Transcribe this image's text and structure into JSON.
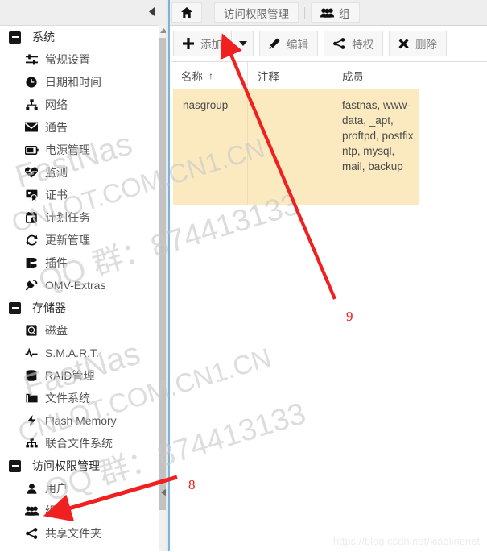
{
  "window": {
    "collapse_sidebar_icon": "triangle-left-icon"
  },
  "breadcrumb": {
    "home_icon": "home-icon",
    "items": [
      {
        "label": "访问权限管理",
        "icon": ""
      },
      {
        "label": "组",
        "icon": "group-icon"
      }
    ]
  },
  "sidebar": {
    "scroll_up_icon": "triangle-up-icon",
    "collapse_handle_icon": "triangle-left-icon",
    "groups": [
      {
        "label": "系统",
        "items": [
          {
            "label": "常规设置",
            "icon": "sliders-icon"
          },
          {
            "label": "日期和时间",
            "icon": "clock-icon"
          },
          {
            "label": "网络",
            "icon": "network-icon"
          },
          {
            "label": "通告",
            "icon": "envelope-icon"
          },
          {
            "label": "电源管理",
            "icon": "battery-icon"
          },
          {
            "label": "监测",
            "icon": "heartbeat-icon"
          },
          {
            "label": "证书",
            "icon": "certificate-icon"
          },
          {
            "label": "计划任务",
            "icon": "calendar-clock-icon"
          },
          {
            "label": "更新管理",
            "icon": "refresh-icon"
          },
          {
            "label": "插件",
            "icon": "plug-puzzle-icon"
          },
          {
            "label": "OMV-Extras",
            "icon": "plug-icon"
          }
        ]
      },
      {
        "label": "存储器",
        "items": [
          {
            "label": "磁盘",
            "icon": "harddisk-icon"
          },
          {
            "label": "S.M.A.R.T.",
            "icon": "pulse-icon"
          },
          {
            "label": "RAID管理",
            "icon": "database-icon"
          },
          {
            "label": "文件系统",
            "icon": "folder-icon"
          },
          {
            "label": "Flash Memory",
            "icon": "bolt-icon"
          },
          {
            "label": "联合文件系统",
            "icon": "sitemap-icon"
          }
        ]
      },
      {
        "label": "访问权限管理",
        "items": [
          {
            "label": "用户",
            "icon": "user-icon"
          },
          {
            "label": "组",
            "icon": "group-icon"
          },
          {
            "label": "共享文件夹",
            "icon": "share-icon"
          }
        ]
      }
    ]
  },
  "toolbar": {
    "buttons": [
      {
        "label": "添加",
        "icon": "plus-icon"
      },
      {
        "label": "编辑",
        "icon": "pencil-icon"
      },
      {
        "label": "特权",
        "icon": "share-icon"
      },
      {
        "label": "删除",
        "icon": "cross-icon"
      }
    ],
    "split_caret_icon": "caret-down-icon"
  },
  "grid": {
    "columns": [
      {
        "label": "名称",
        "sort": "↑"
      },
      {
        "label": "注释",
        "sort": ""
      },
      {
        "label": "成员",
        "sort": ""
      }
    ],
    "rows": [
      {
        "name": "nasgroup",
        "comment": "",
        "members": "fastnas, www-data, _apt, proftpd, postfix, ntp, mysql, mail, backup"
      }
    ],
    "selected_row_color": "#fbeabf"
  },
  "annotations": {
    "color": "#f02020",
    "markers": [
      {
        "id": "9",
        "label": "9"
      },
      {
        "id": "8",
        "label": "8"
      }
    ]
  },
  "watermarks": {
    "lines": [
      "FastNas",
      "CNLOT.COM.CN1.CN",
      "QQ 群：874413133"
    ],
    "footer": "https://blog.csdn.net/xiaolinenet"
  }
}
